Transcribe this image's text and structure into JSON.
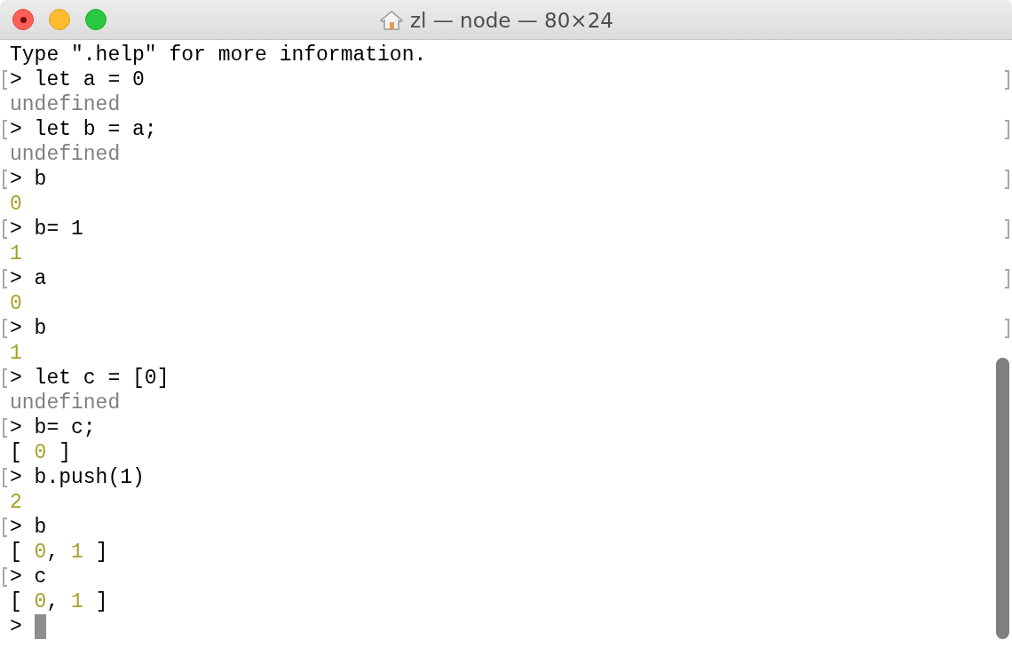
{
  "window": {
    "title": "zl — node — 80×24"
  },
  "lines": [
    {
      "kind": "text",
      "text": "Type \".help\" for more information."
    },
    {
      "kind": "prompt",
      "prompt": ">",
      "input": "let a = 0",
      "marked": true
    },
    {
      "kind": "result",
      "parts": [
        {
          "kind": "undefined",
          "text": "undefined"
        }
      ]
    },
    {
      "kind": "prompt",
      "prompt": ">",
      "input": "let b = a;",
      "marked": true
    },
    {
      "kind": "result",
      "parts": [
        {
          "kind": "undefined",
          "text": "undefined"
        }
      ]
    },
    {
      "kind": "prompt",
      "prompt": ">",
      "input": "b",
      "marked": true
    },
    {
      "kind": "result",
      "parts": [
        {
          "kind": "number",
          "text": "0"
        }
      ]
    },
    {
      "kind": "prompt",
      "prompt": ">",
      "input": "b= 1",
      "marked": true
    },
    {
      "kind": "result",
      "parts": [
        {
          "kind": "number",
          "text": "1"
        }
      ]
    },
    {
      "kind": "prompt",
      "prompt": ">",
      "input": "a",
      "marked": true
    },
    {
      "kind": "result",
      "parts": [
        {
          "kind": "number",
          "text": "0"
        }
      ]
    },
    {
      "kind": "prompt",
      "prompt": ">",
      "input": "b",
      "marked": true
    },
    {
      "kind": "result",
      "parts": [
        {
          "kind": "number",
          "text": "1"
        }
      ]
    },
    {
      "kind": "prompt",
      "prompt": ">",
      "input": "let c = [0]",
      "marked": true
    },
    {
      "kind": "result",
      "parts": [
        {
          "kind": "undefined",
          "text": "undefined"
        }
      ]
    },
    {
      "kind": "prompt",
      "prompt": ">",
      "input": "b= c;",
      "marked": true
    },
    {
      "kind": "result",
      "parts": [
        {
          "kind": "plain",
          "text": "[ "
        },
        {
          "kind": "number",
          "text": "0"
        },
        {
          "kind": "plain",
          "text": " ]"
        }
      ]
    },
    {
      "kind": "prompt",
      "prompt": ">",
      "input": "b.push(1)",
      "marked": true
    },
    {
      "kind": "result",
      "parts": [
        {
          "kind": "number",
          "text": "2"
        }
      ]
    },
    {
      "kind": "prompt",
      "prompt": ">",
      "input": "b",
      "marked": true
    },
    {
      "kind": "result",
      "parts": [
        {
          "kind": "plain",
          "text": "[ "
        },
        {
          "kind": "number",
          "text": "0"
        },
        {
          "kind": "plain",
          "text": ", "
        },
        {
          "kind": "number",
          "text": "1"
        },
        {
          "kind": "plain",
          "text": " ]"
        }
      ]
    },
    {
      "kind": "prompt",
      "prompt": ">",
      "input": "c",
      "marked": true
    },
    {
      "kind": "result",
      "parts": [
        {
          "kind": "plain",
          "text": "[ "
        },
        {
          "kind": "number",
          "text": "0"
        },
        {
          "kind": "plain",
          "text": ", "
        },
        {
          "kind": "number",
          "text": "1"
        },
        {
          "kind": "plain",
          "text": " ]"
        }
      ]
    },
    {
      "kind": "prompt",
      "prompt": ">",
      "marked": false,
      "cursor": true
    }
  ]
}
